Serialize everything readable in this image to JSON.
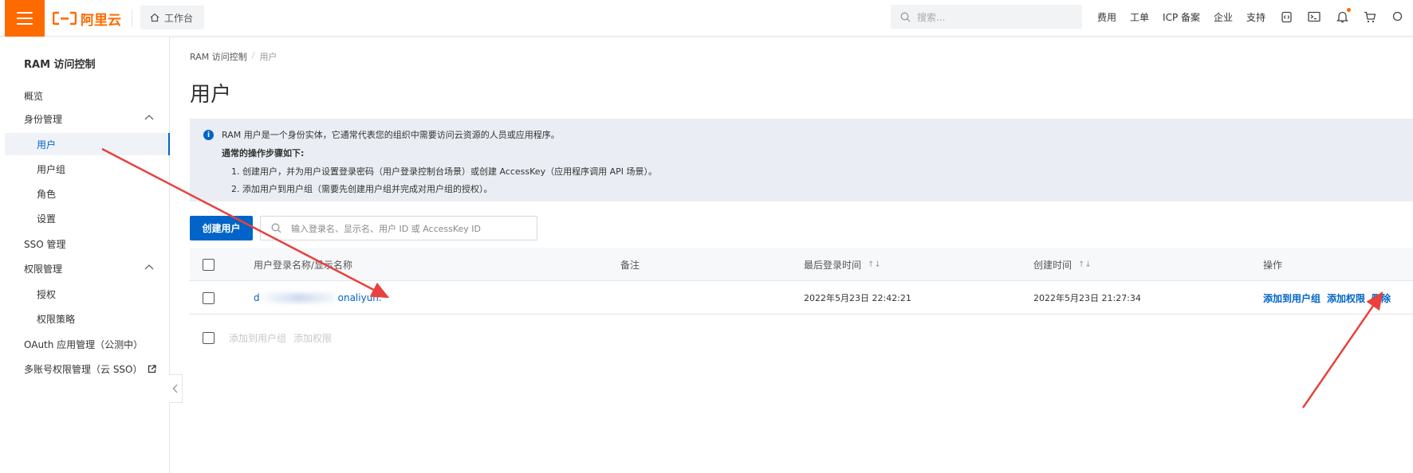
{
  "topbar": {
    "logo_text": "阿里云",
    "workbench_label": "工作台",
    "search_placeholder": "搜索...",
    "nav_items": [
      "费用",
      "工单",
      "ICP 备案",
      "企业",
      "支持"
    ]
  },
  "sidebar": {
    "title": "RAM 访问控制",
    "items": [
      {
        "label": "概览"
      },
      {
        "label": "身份管理"
      },
      {
        "label": "用户"
      },
      {
        "label": "用户组"
      },
      {
        "label": "角色"
      },
      {
        "label": "设置"
      },
      {
        "label": "SSO 管理"
      },
      {
        "label": "权限管理"
      },
      {
        "label": "授权"
      },
      {
        "label": "权限策略"
      },
      {
        "label": "OAuth 应用管理（公测中）"
      },
      {
        "label": "多账号权限管理（云 SSO）"
      }
    ]
  },
  "breadcrumb": {
    "root": "RAM 访问控制",
    "separator": "/",
    "current": "用户"
  },
  "page_title": "用户",
  "info": {
    "line1": "RAM 用户是一个身份实体，它通常代表您的组织中需要访问云资源的人员或应用程序。",
    "line2": "通常的操作步骤如下:",
    "line3": "1. 创建用户，并为用户设置登录密码（用户登录控制台场景）或创建 AccessKey（应用程序调用 API 场景）。",
    "line4": "2. 添加用户到用户组（需要先创建用户组并完成对用户组的授权）。"
  },
  "toolbar": {
    "create_label": "创建用户",
    "filter_placeholder": "输入登录名、显示名、用户 ID 或 AccessKey ID"
  },
  "table": {
    "headers": {
      "name": "用户登录名称/显示名称",
      "note": "备注",
      "last_login": "最后登录时间",
      "created": "创建时间",
      "actions": "操作"
    },
    "sort_symbol": "↑↓",
    "rows": [
      {
        "name_prefix": "d",
        "name_suffix": "onaliyun.",
        "last_login": "2022年5月23日 22:42:21",
        "created": "2022年5月23日 21:27:34",
        "actions": [
          "添加到用户组",
          "添加权限",
          "删除"
        ]
      }
    ]
  },
  "batch_actions": [
    "添加到用户组",
    "添加权限"
  ],
  "colors": {
    "brand": "#ff6a00",
    "primary": "#0064c8",
    "annotation": "#e8413e"
  }
}
